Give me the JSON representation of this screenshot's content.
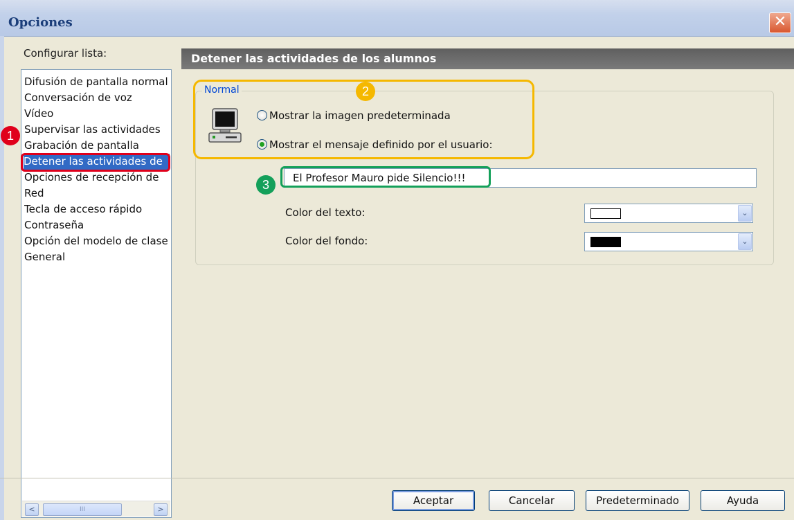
{
  "window": {
    "title": "Opciones",
    "close_glyph": "✕"
  },
  "sidebar": {
    "label": "Configurar lista:",
    "items": [
      {
        "label": "Difusión de pantalla normal"
      },
      {
        "label": "Conversación de voz"
      },
      {
        "label": "Vídeo"
      },
      {
        "label": "Supervisar las actividades"
      },
      {
        "label": "Grabación de pantalla"
      },
      {
        "label": "Detener las actividades de"
      },
      {
        "label": "Opciones de recepción de"
      },
      {
        "label": "Red"
      },
      {
        "label": "Tecla de acceso rápido"
      },
      {
        "label": "Contraseña"
      },
      {
        "label": "Opción del modelo de clase"
      },
      {
        "label": "General"
      }
    ],
    "selected_index": 5,
    "scroll_left_glyph": "<",
    "scroll_right_glyph": ">",
    "scroll_thumb_glyph": "III"
  },
  "panel": {
    "header": "Detener las actividades de los alumnos",
    "group_label": "Normal",
    "icon": "computer-icon",
    "radio_default_image": "Mostrar la imagen predeterminada",
    "radio_user_message": "Mostrar el mensaje definido por el usuario:",
    "selected_radio": "radio_user_message",
    "message_value": "El Profesor Mauro pide Silencio!!!",
    "text_color_label": "Color del texto:",
    "text_color_value": "#FFFFFF",
    "bg_color_label": "Color del fondo:",
    "bg_color_value": "#000000",
    "dropdown_glyph": "⌄"
  },
  "buttons": {
    "ok": "Aceptar",
    "cancel": "Cancelar",
    "default": "Predeterminado",
    "help": "Ayuda"
  },
  "annotations": {
    "badge1": "1",
    "badge2": "2",
    "badge3": "3",
    "color1": "#E0001B",
    "color2": "#F5B800",
    "color3": "#14A05A"
  }
}
